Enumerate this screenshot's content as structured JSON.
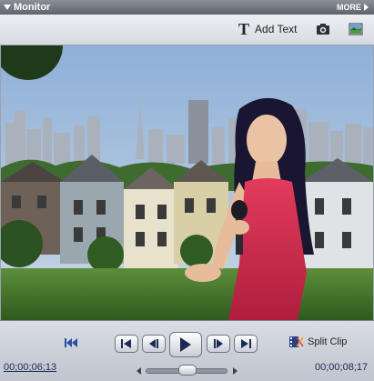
{
  "panel": {
    "title": "Monitor",
    "more_label": "MORE"
  },
  "toolbar": {
    "add_text_label": "Add Text",
    "add_text_icon": "text-t-icon",
    "snapshot_icon": "camera-icon",
    "background_icon": "image-icon"
  },
  "controls": {
    "timecode_current": "00;00;06;13",
    "timecode_duration": "00;00;08;17",
    "split_clip_label": "Split Clip",
    "buttons": [
      "go-to-start",
      "go-to-previous-edit",
      "step-back",
      "play",
      "step-forward",
      "go-to-next-edit"
    ]
  },
  "colors": {
    "accent": "#1a2a55",
    "titlebar": "#6e737b"
  }
}
